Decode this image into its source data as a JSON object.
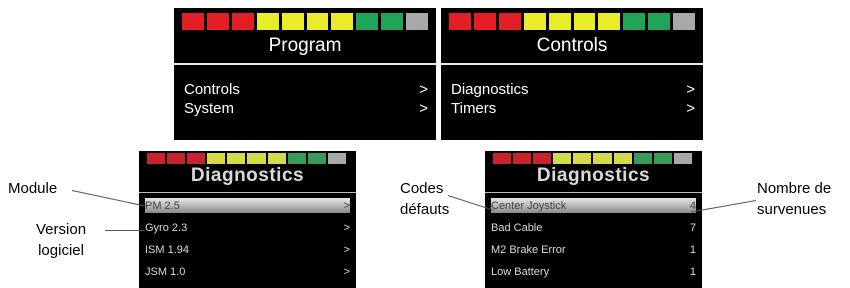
{
  "colors": {
    "red": "#e31e24",
    "yellow": "#e8ec2a",
    "green": "#1ea55a",
    "grey": "#a8a8a8"
  },
  "screens": {
    "program": {
      "title": "Program",
      "items": [
        {
          "label": "Controls",
          "arrow": ">"
        },
        {
          "label": "System",
          "arrow": ">"
        }
      ]
    },
    "controls": {
      "title": "Controls",
      "items": [
        {
          "label": "Diagnostics",
          "arrow": ">"
        },
        {
          "label": "Timers",
          "arrow": ">"
        }
      ]
    },
    "diag_left": {
      "title": "Diagnostics",
      "items": [
        {
          "label": "PM 2.5",
          "arrow": ">"
        },
        {
          "label": "Gyro 2.3",
          "arrow": ">"
        },
        {
          "label": "ISM 1.94",
          "arrow": ">"
        },
        {
          "label": "JSM 1.0",
          "arrow": ">"
        }
      ]
    },
    "diag_right": {
      "title": "Diagnostics",
      "items": [
        {
          "label": "Center Joystick",
          "count": "4"
        },
        {
          "label": "Bad Cable",
          "count": "7"
        },
        {
          "label": "M2 Brake Error",
          "count": "1"
        },
        {
          "label": "Low Battery",
          "count": "1"
        }
      ]
    }
  },
  "callouts": {
    "module": "Module",
    "version_line1": "Version",
    "version_line2": "logiciel",
    "codes_line1": "Codes",
    "codes_line2": "défauts",
    "count_line1": "Nombre de",
    "count_line2": "survenues"
  }
}
